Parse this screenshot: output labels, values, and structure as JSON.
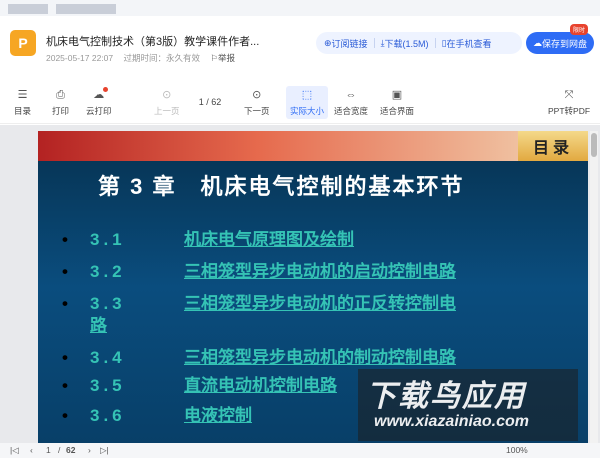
{
  "file": {
    "icon_letter": "P",
    "title": "机床电气控制技术（第3版）教学课件作者...",
    "date": "2025-05-17 22:07",
    "expiry": "过期时间：永久有效",
    "report": "举报"
  },
  "actions": {
    "subscribe": "订阅链接",
    "download": "下载(1.5M)",
    "mobile": "在手机查看",
    "save": "保存到网盘",
    "hot_badge": "限时"
  },
  "toolbar": {
    "toc": "目录",
    "print": "打印",
    "cloud_print": "云打印",
    "prev": "上一页",
    "page_current": "1",
    "page_total": "62",
    "next": "下一页",
    "actual_size": "实际大小",
    "fit_width": "适合宽度",
    "fit_page": "适合界面",
    "ppt_to_pdf": "PPT转PDF"
  },
  "slide": {
    "corner": "目录",
    "title": "第 3 章　机床电气控制的基本环节",
    "items": [
      {
        "num": "3.1",
        "text": "机床电气原理图及绘制"
      },
      {
        "num": "3.2",
        "text": "三相笼型异步电动机的启动控制电路"
      },
      {
        "num": "3.3",
        "text": "三相笼型异步电动机的正反转控制电"
      },
      {
        "num": "",
        "text": "路"
      },
      {
        "num": "3.4",
        "text": "三相笼型异步电动机的制动控制电路"
      },
      {
        "num": "3.5",
        "text": "直流电动机控制电路"
      },
      {
        "num": "3.6",
        "text": "电液控制"
      }
    ]
  },
  "watermark": {
    "big": "下载鸟应用",
    "url": "www.xiazainiao.com"
  },
  "bottom": {
    "page_current": "1",
    "page_total": "62",
    "zoom": "100%"
  }
}
